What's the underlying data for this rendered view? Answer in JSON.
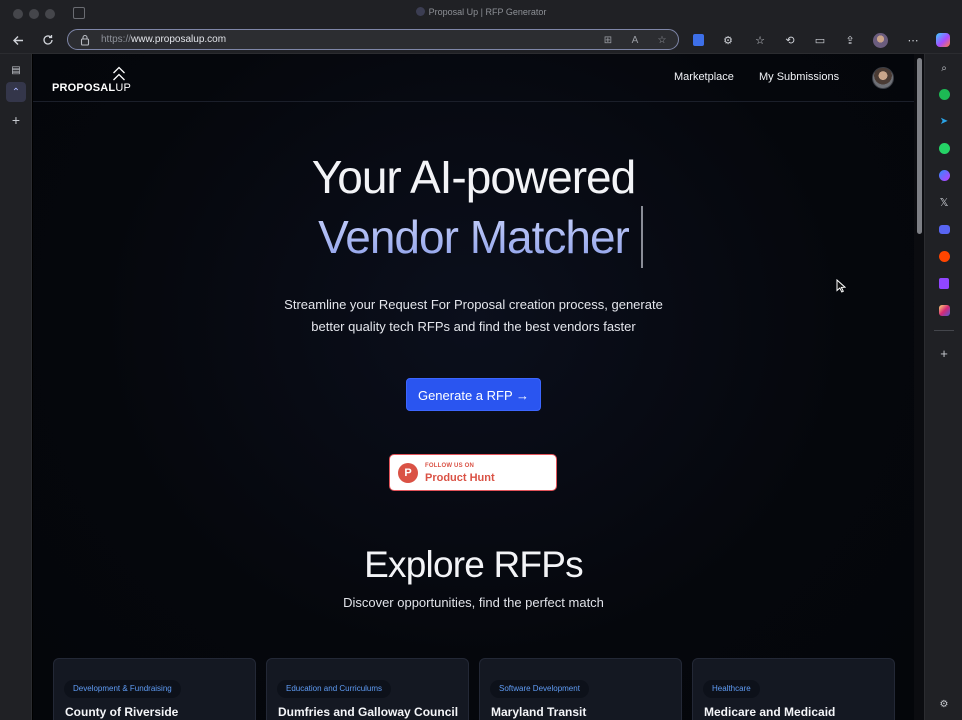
{
  "window": {
    "title": "Proposal Up | RFP Generator"
  },
  "browser": {
    "url_protocol": "https://",
    "url_host": "www.proposalup.com"
  },
  "site": {
    "logo_text_bold": "PROPOSAL",
    "logo_text_light": "UP",
    "nav": {
      "marketplace": "Marketplace",
      "submissions": "My Submissions"
    }
  },
  "hero": {
    "line1": "Your AI-powered",
    "line2": "Vendor Matcher",
    "subtitle": "Streamline your Request For Proposal creation process, generate better quality tech RFPs and find the best vendors faster",
    "cta": "Generate a RFP →"
  },
  "product_hunt": {
    "small": "FOLLOW US ON",
    "big": "Product Hunt",
    "letter": "P"
  },
  "explore": {
    "title": "Explore RFPs",
    "subtitle": "Discover opportunities, find the perfect match"
  },
  "cards": [
    {
      "tag": "Development & Fundraising",
      "title": "County of Riverside"
    },
    {
      "tag": "Education and Curriculums",
      "title": "Dumfries and Galloway Council"
    },
    {
      "tag": "Software Development",
      "title": "Maryland Transit"
    },
    {
      "tag": "Healthcare",
      "title": "Medicare and Medicaid"
    }
  ],
  "colors": {
    "cta": "#2a55f0",
    "accent_gradient": "#a9b8f2",
    "tag_text": "#5f9cf5",
    "product_hunt": "#da5245"
  },
  "icons": [
    "back-arrow-icon",
    "reload-icon",
    "lock-icon",
    "grid-icon",
    "read-aloud-icon",
    "star-icon",
    "bitwarden-icon",
    "extensions-icon",
    "favorites-icon",
    "history-icon",
    "screen-capture-icon",
    "share-icon",
    "profile-icon",
    "more-icon",
    "copilot-icon"
  ]
}
